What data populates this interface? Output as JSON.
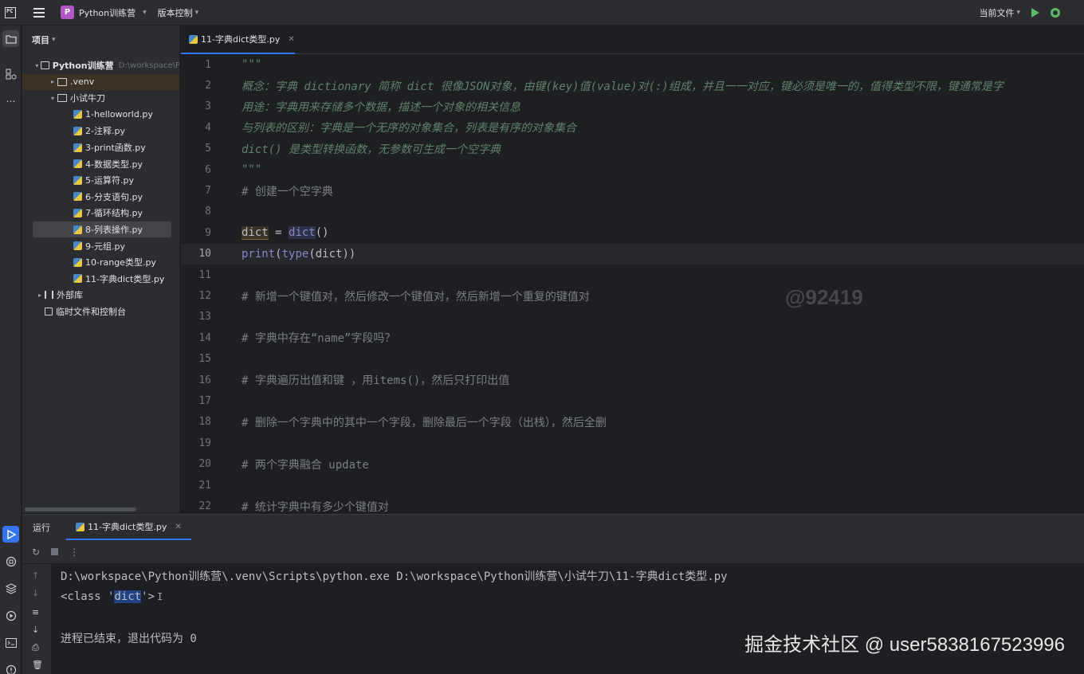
{
  "titlebar": {
    "logo_text": "PC",
    "project_badge": "P",
    "project_name": "Python训练营",
    "vcs_label": "版本控制",
    "run_config": "当前文件"
  },
  "project_panel": {
    "header": "项目",
    "tree": [
      {
        "label": "Python训练营",
        "path_hint": "D:\\workspace\\P",
        "type": "root",
        "depth": 0,
        "expanded": true
      },
      {
        "label": ".venv",
        "type": "folder",
        "depth": 1,
        "expanded": false
      },
      {
        "label": "小试牛刀",
        "type": "folder",
        "depth": 1,
        "expanded": true
      },
      {
        "label": "1-helloworld.py",
        "type": "py",
        "depth": 2
      },
      {
        "label": "2-注释.py",
        "type": "py",
        "depth": 2
      },
      {
        "label": "3-print函数.py",
        "type": "py",
        "depth": 2
      },
      {
        "label": "4-数据类型.py",
        "type": "py",
        "depth": 2
      },
      {
        "label": "5-运算符.py",
        "type": "py",
        "depth": 2
      },
      {
        "label": "6-分支语句.py",
        "type": "py",
        "depth": 2
      },
      {
        "label": "7-循环结构.py",
        "type": "py",
        "depth": 2
      },
      {
        "label": "8-列表操作.py",
        "type": "py",
        "depth": 2,
        "selected": true
      },
      {
        "label": "9-元组.py",
        "type": "py",
        "depth": 2
      },
      {
        "label": "10-range类型.py",
        "type": "py",
        "depth": 2
      },
      {
        "label": "11-字典dict类型.py",
        "type": "py",
        "depth": 2
      },
      {
        "label": "外部库",
        "type": "lib",
        "depth": 0,
        "expanded": false
      },
      {
        "label": "临时文件和控制台",
        "type": "scratch",
        "depth": 0
      }
    ]
  },
  "editor": {
    "tab_label": "11-字典dict类型.py",
    "current_line": 10,
    "lines": [
      {
        "n": "1",
        "text": "\"\"\"",
        "kind": "doc"
      },
      {
        "n": "2",
        "text": "概念：字典 dictionary 简称 dict 很像JSON对象，由键(key)值(value)对(:)组成，并且一一对应，键必须是唯一的，值得类型不限，键通常是字",
        "kind": "doc"
      },
      {
        "n": "3",
        "text": "用途：字典用来存储多个数据，描述一个对象的相关信息",
        "kind": "doc"
      },
      {
        "n": "4",
        "text": "与列表的区别：字典是一个无序的对象集合，列表是有序的对象集合",
        "kind": "doc"
      },
      {
        "n": "5",
        "text": "dict() 是类型转换函数，无参数可生成一个空字典",
        "kind": "doc"
      },
      {
        "n": "6",
        "text": "\"\"\"",
        "kind": "doc"
      },
      {
        "n": "7",
        "text": "# 创建一个空字典",
        "kind": "cmt"
      },
      {
        "n": "8",
        "text": "",
        "kind": "blank"
      },
      {
        "n": "9",
        "text": "",
        "kind": "code9"
      },
      {
        "n": "10",
        "text": "",
        "kind": "code10"
      },
      {
        "n": "11",
        "text": "",
        "kind": "blank"
      },
      {
        "n": "12",
        "text": "# 新增一个键值对，然后修改一个键值对，然后新增一个重复的键值对",
        "kind": "cmt"
      },
      {
        "n": "13",
        "text": "",
        "kind": "blank"
      },
      {
        "n": "14",
        "text": "# 字典中存在“name”字段吗？",
        "kind": "cmt"
      },
      {
        "n": "15",
        "text": "",
        "kind": "blank"
      },
      {
        "n": "16",
        "text": "# 字典遍历出值和键 ，用items()，然后只打印出值",
        "kind": "cmt"
      },
      {
        "n": "17",
        "text": "",
        "kind": "blank"
      },
      {
        "n": "18",
        "text": "# 删除一个字典中的其中一个字段，删除最后一个字段（出栈），然后全删",
        "kind": "cmt"
      },
      {
        "n": "19",
        "text": "",
        "kind": "blank"
      },
      {
        "n": "20",
        "text": "# 两个字典融合 update",
        "kind": "cmt"
      },
      {
        "n": "21",
        "text": "",
        "kind": "blank"
      },
      {
        "n": "22",
        "text": "# 统计字典中有多少个键值对",
        "kind": "cmt"
      }
    ],
    "code9": {
      "var": "dict",
      "op": " = ",
      "call": "dict",
      "parens": "()"
    },
    "code10": {
      "fn": "print",
      "open": "(",
      "inner_fn": "type",
      "inner": "(dict)",
      "close": ")"
    },
    "overlay_id": "@92419"
  },
  "run_panel": {
    "label": "运行",
    "tab_label": "11-字典dict类型.py",
    "console": {
      "command": "D:\\workspace\\Python训练营\\.venv\\Scripts\\python.exe D:\\workspace\\Python训练营\\小试牛刀\\11-字典dict类型.py",
      "out_prefix": "<class '",
      "out_word": "dict",
      "out_suffix": "'>",
      "exit_msg": "进程已结束，退出代码为 0"
    }
  },
  "watermark": "掘金技术社区 @ user5838167523996",
  "colors": {
    "accent": "#3574f0",
    "run_green": "#5fb865",
    "project_badge": "#b359c7"
  }
}
